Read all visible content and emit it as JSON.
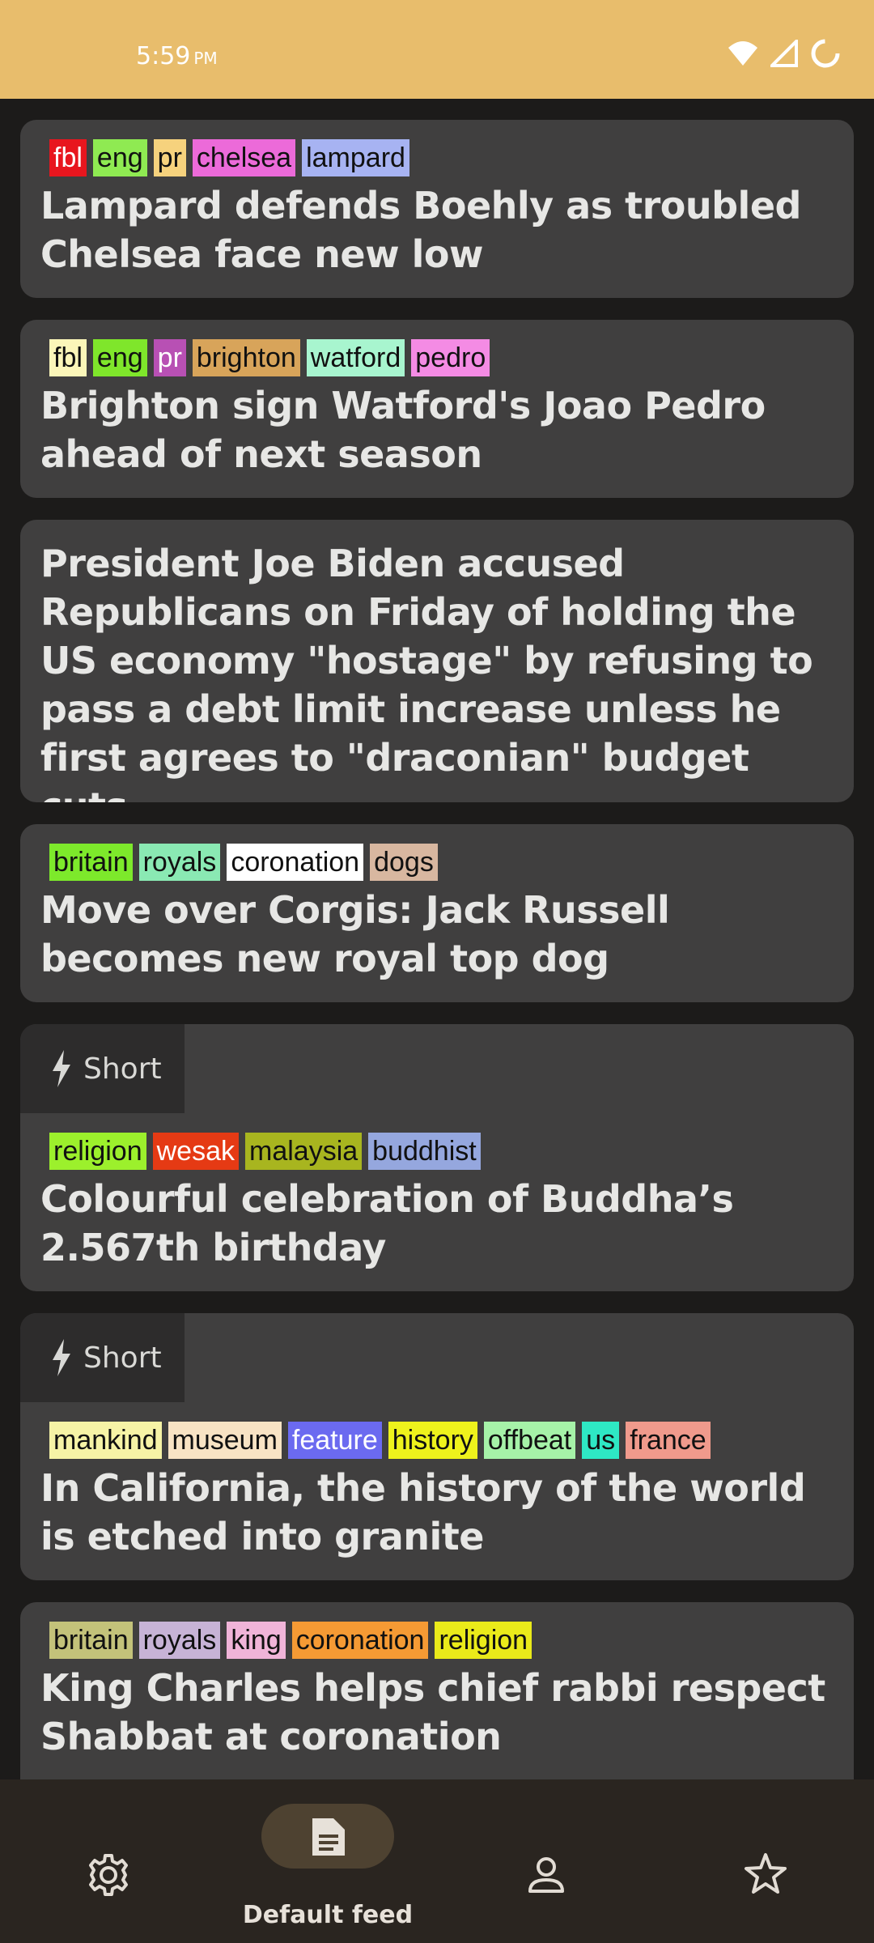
{
  "status": {
    "time": "5:59",
    "ampm": "PM"
  },
  "cards": [
    {
      "tags": [
        {
          "label": "fbl",
          "bg": "#e8161e",
          "fg": "#ffffff"
        },
        {
          "label": "eng",
          "bg": "#8fea52",
          "fg": "#111111"
        },
        {
          "label": "pr",
          "bg": "#f6d27d",
          "fg": "#111111"
        },
        {
          "label": "chelsea",
          "bg": "#ec6ad9",
          "fg": "#111111"
        },
        {
          "label": "lampard",
          "bg": "#a7b3f2",
          "fg": "#111111"
        }
      ],
      "headline": "Lampard defends Boehly as troubled Chelsea face new low"
    },
    {
      "tags": [
        {
          "label": "fbl",
          "bg": "#fbf6b9",
          "fg": "#111111"
        },
        {
          "label": "eng",
          "bg": "#7fe62b",
          "fg": "#111111"
        },
        {
          "label": "pr",
          "bg": "#b850b4",
          "fg": "#ffffff"
        },
        {
          "label": "brighton",
          "bg": "#d8a45a",
          "fg": "#111111"
        },
        {
          "label": "watford",
          "bg": "#a8f5cf",
          "fg": "#111111"
        },
        {
          "label": "pedro",
          "bg": "#f48be4",
          "fg": "#111111"
        }
      ],
      "headline": "Brighton sign Watford's Joao Pedro ahead of next season"
    },
    {
      "tags": [],
      "headline": "President Joe Biden accused Republicans on Friday of holding the US economy \"hostage\" by refusing to pass a debt limit increase unless he first agrees to \"draconian\" budget cuts."
    },
    {
      "tags": [
        {
          "label": "britain",
          "bg": "#7de92b",
          "fg": "#111111"
        },
        {
          "label": "royals",
          "bg": "#8ae9b3",
          "fg": "#111111"
        },
        {
          "label": "coronation",
          "bg": "#ffffff",
          "fg": "#111111"
        },
        {
          "label": "dogs",
          "bg": "#d8b7a0",
          "fg": "#111111"
        }
      ],
      "headline": "Move over Corgis: Jack Russell becomes new royal top dog"
    },
    {
      "short": "Short",
      "tags": [
        {
          "label": "religion",
          "bg": "#9cf02c",
          "fg": "#111111"
        },
        {
          "label": "wesak",
          "bg": "#e53a14",
          "fg": "#ffffff"
        },
        {
          "label": "malaysia",
          "bg": "#a8b51f",
          "fg": "#111111"
        },
        {
          "label": "buddhist",
          "bg": "#95a7de",
          "fg": "#111111"
        }
      ],
      "headline": "Colourful celebration of Buddha’s 2.567th birthday"
    },
    {
      "short": "Short",
      "tags": [
        {
          "label": "mankind",
          "bg": "#f6f3a6",
          "fg": "#111111"
        },
        {
          "label": "museum",
          "bg": "#f8e3c4",
          "fg": "#111111"
        },
        {
          "label": "feature",
          "bg": "#6b6af0",
          "fg": "#ffffff"
        },
        {
          "label": "history",
          "bg": "#eef21c",
          "fg": "#111111"
        },
        {
          "label": "offbeat",
          "bg": "#a6f2a8",
          "fg": "#111111"
        },
        {
          "label": "us",
          "bg": "#2ee8c4",
          "fg": "#111111"
        },
        {
          "label": "france",
          "bg": "#f09a8c",
          "fg": "#111111"
        }
      ],
      "headline": "In California, the history of the world is etched into granite"
    },
    {
      "tags": [
        {
          "label": "britain",
          "bg": "#c3c27a",
          "fg": "#111111"
        },
        {
          "label": "royals",
          "bg": "#c7b3d6",
          "fg": "#111111"
        },
        {
          "label": "king",
          "bg": "#f0b4d8",
          "fg": "#111111"
        },
        {
          "label": "coronation",
          "bg": "#f59a34",
          "fg": "#111111"
        },
        {
          "label": "religion",
          "bg": "#eaea1a",
          "fg": "#111111"
        }
      ],
      "headline": "King Charles helps chief rabbi respect Shabbat at coronation"
    }
  ],
  "nav": {
    "active_label": "Default feed"
  },
  "colors": {
    "statusbar": "#e8bd6c",
    "card": "#403f3f",
    "background": "#1c1b1a",
    "nav": "#2a2520",
    "nav_pill": "#4e4231"
  }
}
